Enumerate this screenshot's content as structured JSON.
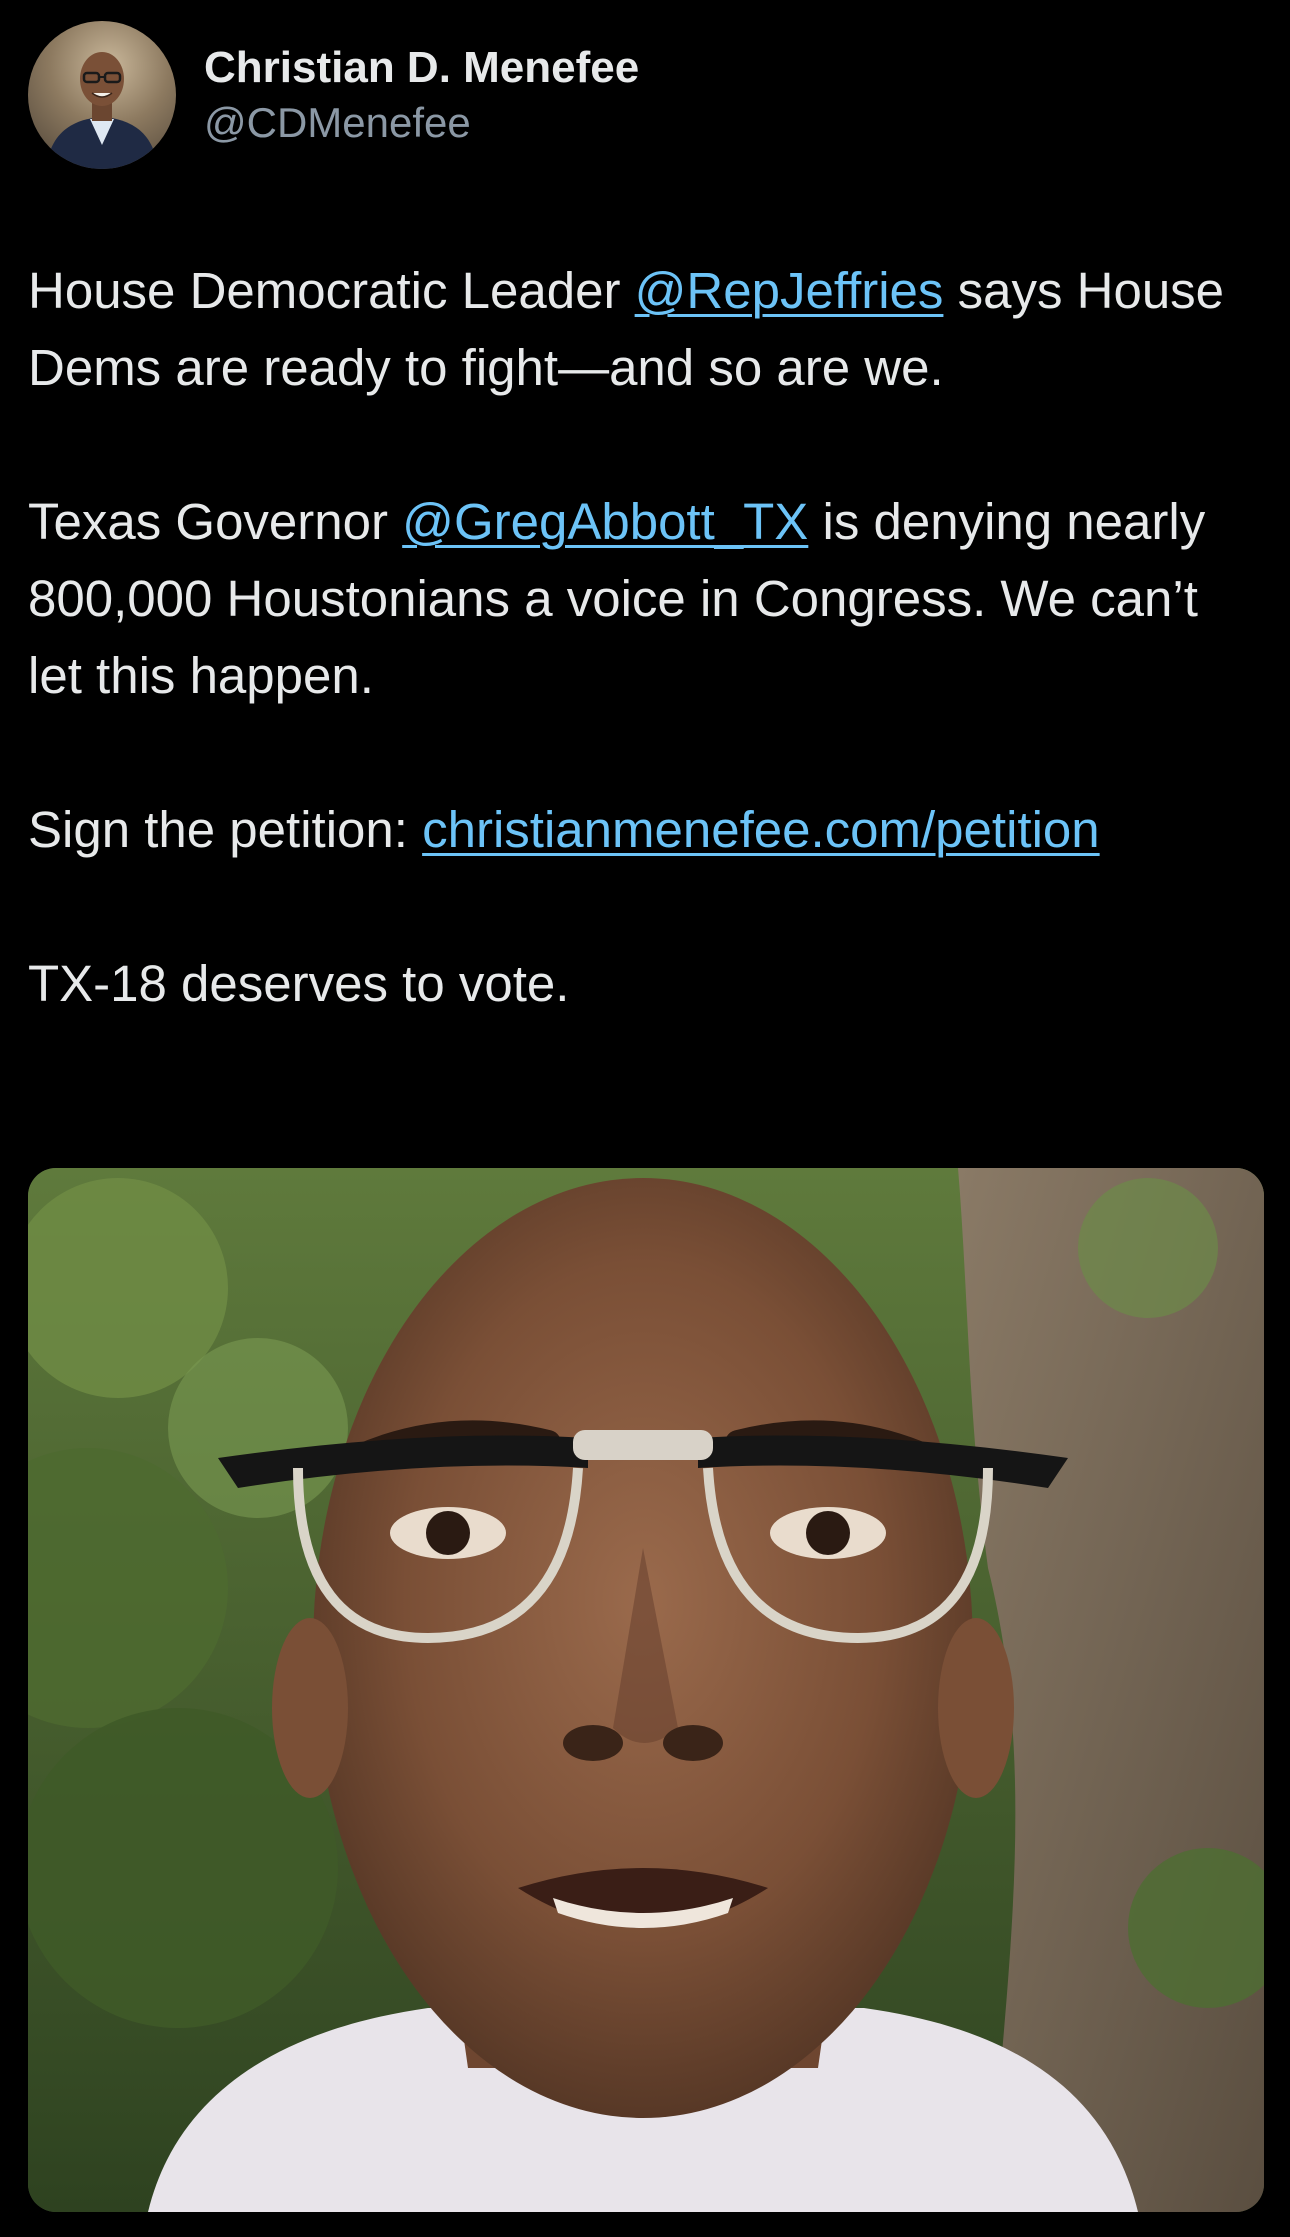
{
  "author": {
    "display_name": "Christian D. Menefee",
    "handle": "@CDMenefee"
  },
  "tweet": {
    "p1_before": "House Democratic Leader ",
    "p1_mention": "@RepJeffries",
    "p1_after": " says House Dems are ready to fight—and so are we.",
    "p2_before": "Texas Governor ",
    "p2_mention": "@GregAbbott_TX",
    "p2_after": " is denying nearly 800,000 Houstonians a voice in Congress. We can’t let this happen.",
    "p3_before": "Sign the petition: ",
    "p3_link": "christianmenefee.com/​petition",
    "p4": "TX-18 deserves to vote."
  },
  "colors": {
    "background": "#000000",
    "text": "#e7e9ea",
    "secondary_text": "#8b98a5",
    "link": "#6cc3f7"
  },
  "icons": {
    "avatar": "profile-photo",
    "media": "video-thumbnail"
  }
}
